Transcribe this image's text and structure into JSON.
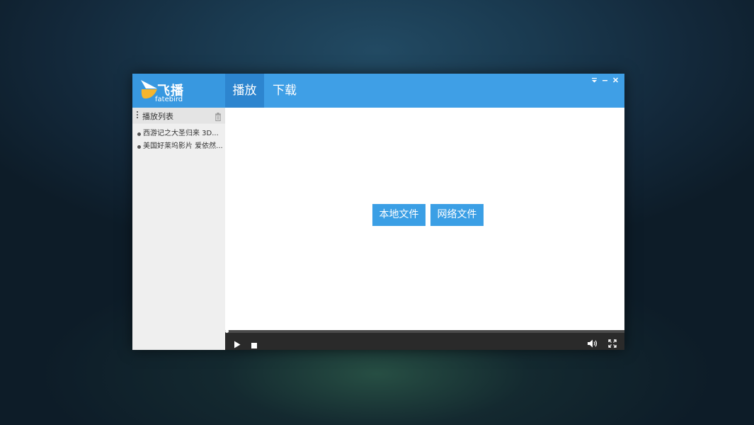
{
  "app": {
    "logo_cn": "飞播",
    "logo_en": "fatebird"
  },
  "tabs": [
    {
      "label": "播放",
      "active": true
    },
    {
      "label": "下载",
      "active": false
    }
  ],
  "window_controls": [
    "menu-icon",
    "minimize-icon",
    "close-icon"
  ],
  "sidebar": {
    "title": "播放列表",
    "items": [
      {
        "label": "西游记之大圣归来 3D..."
      },
      {
        "label": "美国好莱坞影片 爱依然..."
      }
    ]
  },
  "main": {
    "local_file_label": "本地文件",
    "network_file_label": "网络文件"
  },
  "player": {
    "progress": 0.0
  },
  "colors": {
    "accent": "#3f9fe6",
    "active_tab": "#2d85cf",
    "sidebar_bg": "#efefef",
    "controls_bg": "#2a2a2a",
    "logo_yellow": "#f5b52e"
  }
}
